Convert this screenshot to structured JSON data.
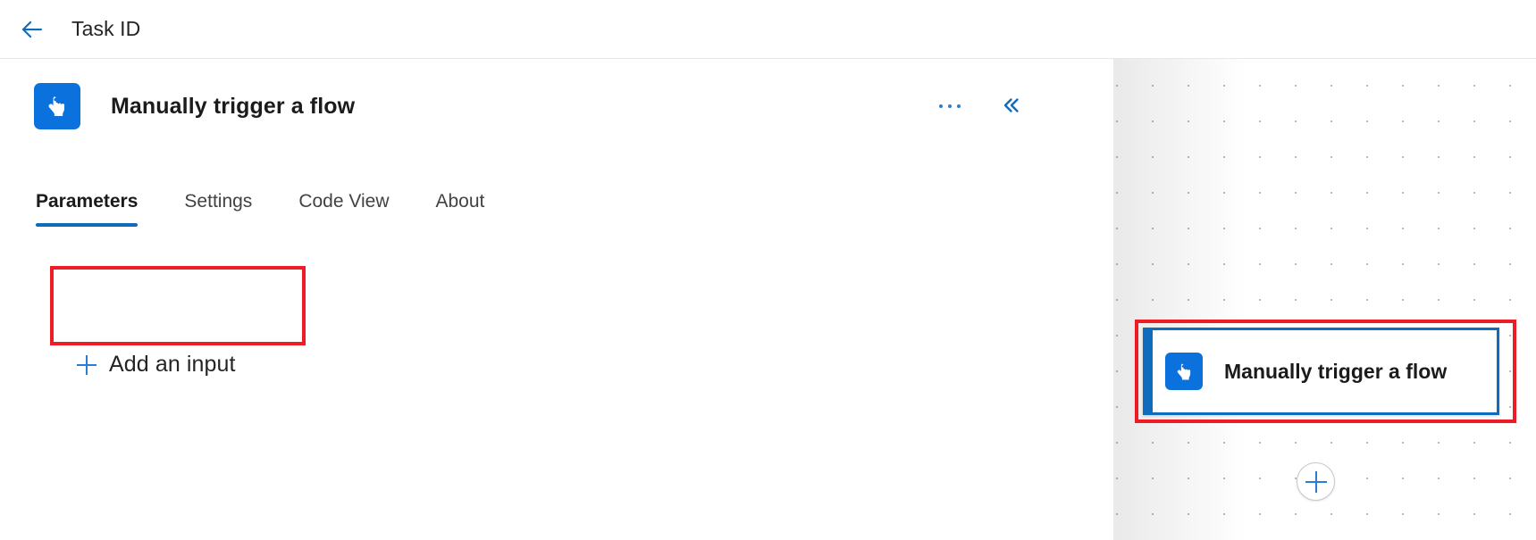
{
  "topbar": {
    "back_icon": "arrow-left-icon",
    "title": "Task ID"
  },
  "panel": {
    "icon": "manual-trigger-hand-icon",
    "title": "Manually trigger a flow",
    "more_actions_icon": "ellipsis-horizontal-icon",
    "collapse_icon": "double-chevron-left-icon",
    "tabs": [
      {
        "label": "Parameters",
        "active": true
      },
      {
        "label": "Settings",
        "active": false
      },
      {
        "label": "Code View",
        "active": false
      },
      {
        "label": "About",
        "active": false
      }
    ],
    "add_input": {
      "icon": "plus-icon",
      "label": "Add an input"
    }
  },
  "canvas": {
    "node": {
      "icon": "manual-trigger-hand-icon",
      "label": "Manually trigger a flow",
      "selected": true
    },
    "add_step": {
      "icon": "plus-icon"
    }
  },
  "colors": {
    "accent_blue": "#0f6cbd",
    "icon_blue": "#0b72dd",
    "highlight_red": "#ef1b26",
    "text_primary": "#1b1b1b",
    "text_secondary": "#424242",
    "canvas_dot": "#b8b8b8"
  }
}
